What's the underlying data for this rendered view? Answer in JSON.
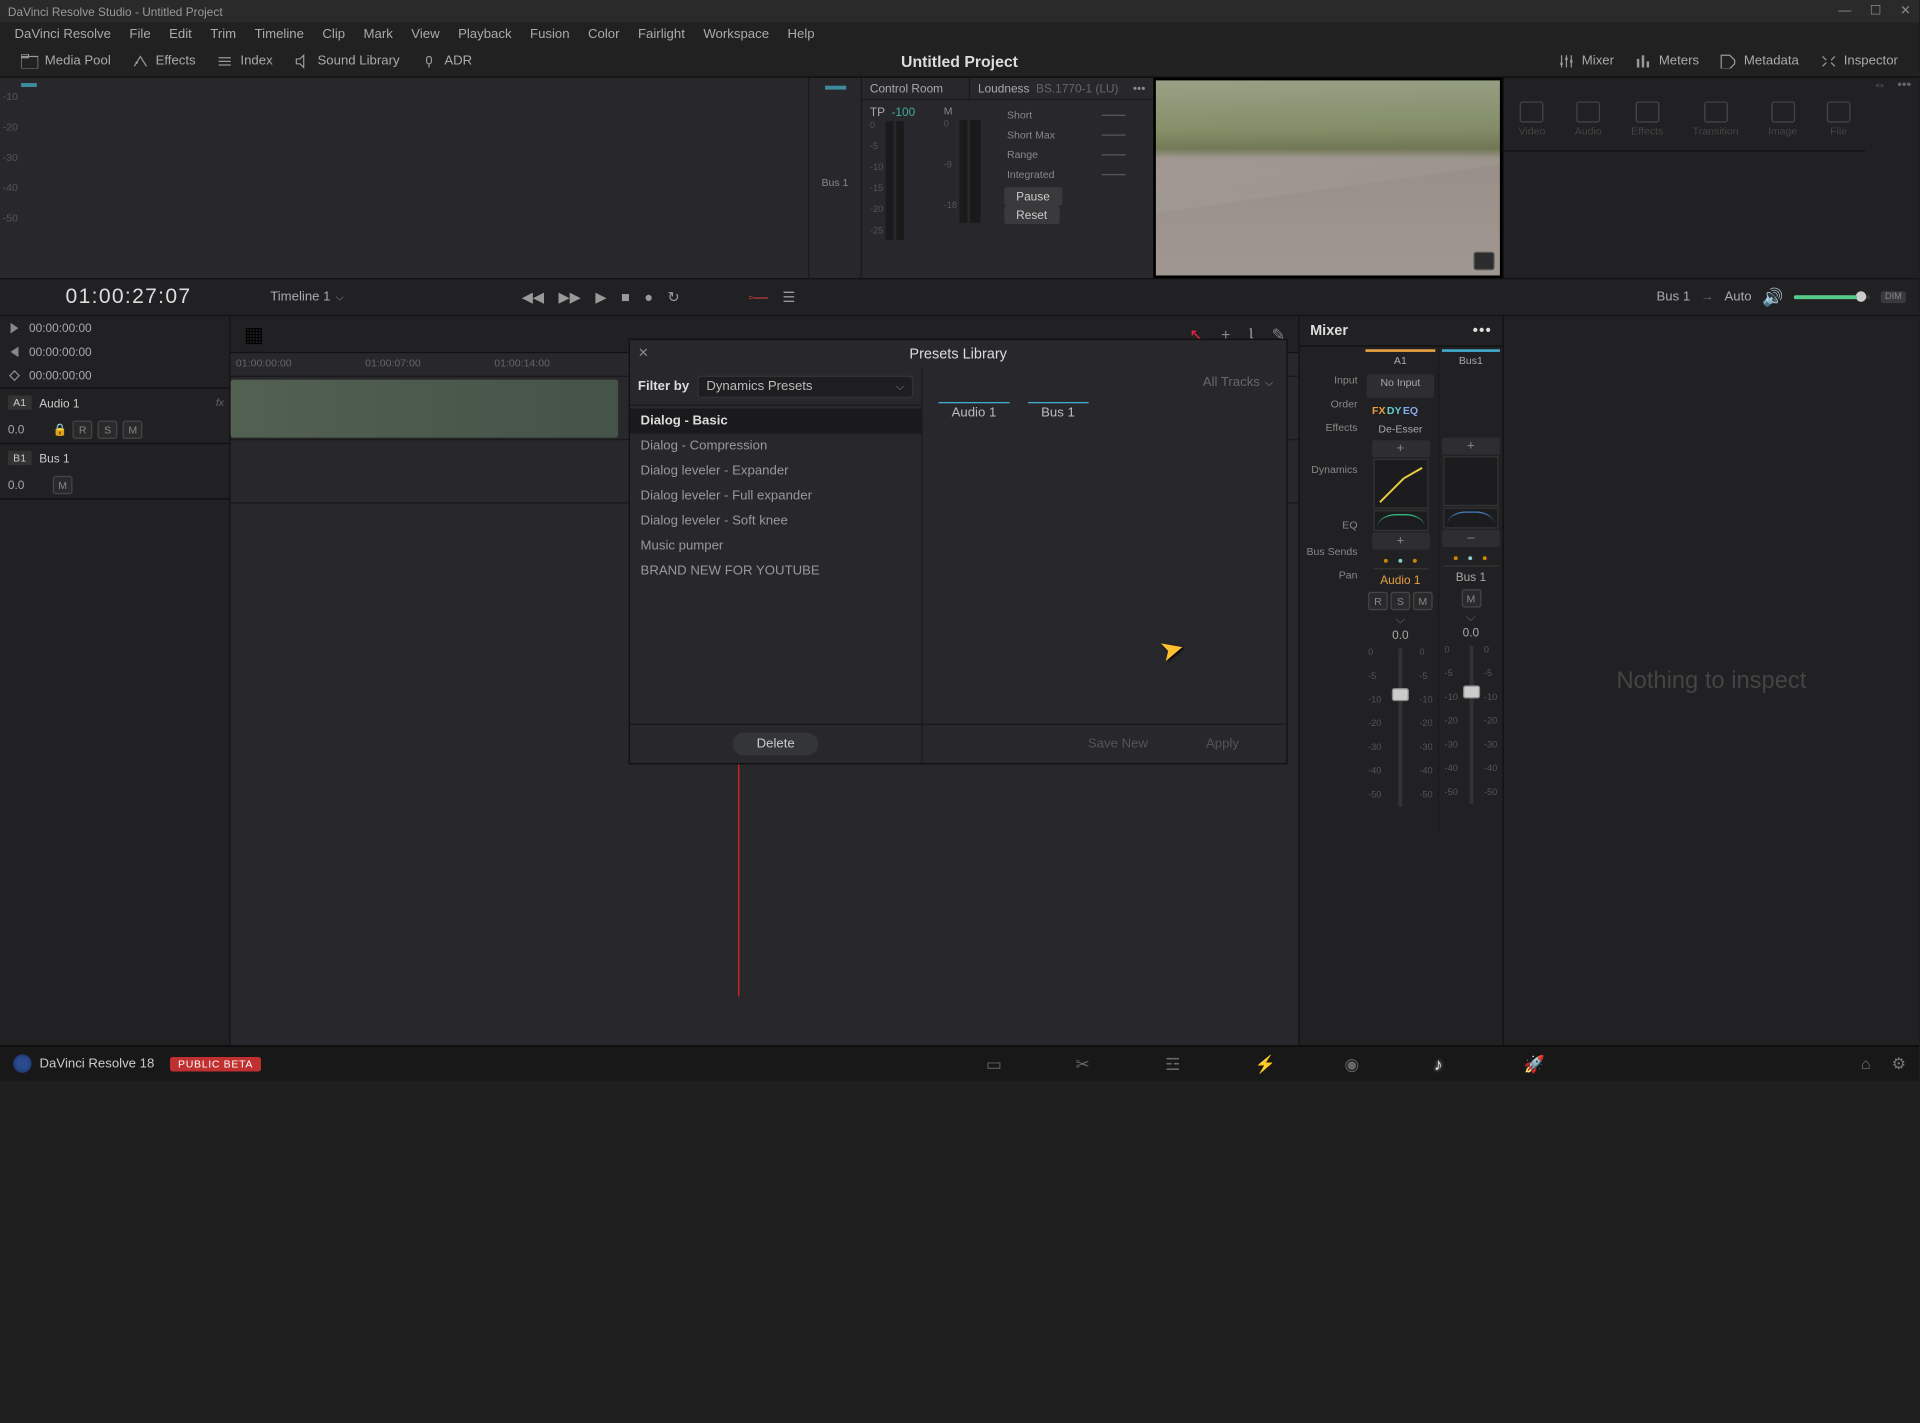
{
  "title_bar": "DaVinci Resolve Studio - Untitled Project",
  "menus": [
    "DaVinci Resolve",
    "File",
    "Edit",
    "Trim",
    "Timeline",
    "Clip",
    "Mark",
    "View",
    "Playback",
    "Fusion",
    "Color",
    "Fairlight",
    "Workspace",
    "Help"
  ],
  "toolbar": {
    "media_pool": "Media Pool",
    "effects": "Effects",
    "index": "Index",
    "sound_library": "Sound Library",
    "adr": "ADR",
    "mixer": "Mixer",
    "meters": "Meters",
    "metadata": "Metadata",
    "inspector": "Inspector"
  },
  "project_title": "Untitled Project",
  "meter_scale": [
    "-10",
    "-20",
    "-30",
    "-40",
    "-50"
  ],
  "bus_meter": {
    "label": "Bus 1"
  },
  "control_room": {
    "title": "Control Room",
    "tp": "TP",
    "tp_val": "-100",
    "tp_scale": [
      "0",
      "-5",
      "-10",
      "-15",
      "-20",
      "-25"
    ]
  },
  "loudness": {
    "title": "Loudness",
    "standard": "BS.1770-1 (LU)",
    "m": "M",
    "short": "Short",
    "short_max": "Short Max",
    "range": "Range",
    "integrated": "Integrated",
    "pause": "Pause",
    "reset": "Reset",
    "m_scale": [
      "0",
      "-9",
      "-18"
    ]
  },
  "inspector_tabs": [
    "Video",
    "Audio",
    "Effects",
    "Transition",
    "Image",
    "File"
  ],
  "timecode": "01:00:27:07",
  "timeline_name": "Timeline 1",
  "tc_rows": [
    "00:00:00:00",
    "00:00:00:00",
    "00:00:00:00"
  ],
  "tracks": [
    {
      "num": "A1",
      "name": "Audio 1",
      "val": "0.0",
      "btns": [
        "R",
        "S",
        "M"
      ],
      "fx": true
    },
    {
      "num": "B1",
      "name": "Bus 1",
      "val": "0.0",
      "btns": [
        "M"
      ],
      "fx": false
    }
  ],
  "ruler": [
    "01:00:00:00",
    "01:00:07:00",
    "01:00:14:00"
  ],
  "mix_out": {
    "bus": "Bus 1",
    "auto": "Auto",
    "dim": "DIM"
  },
  "presets": {
    "title": "Presets Library",
    "close": "✕",
    "filter_label": "Filter by",
    "filter_value": "Dynamics Presets",
    "items": [
      "Dialog - Basic",
      "Dialog - Compression",
      "Dialog leveler - Expander",
      "Dialog leveler - Full expander",
      "Dialog leveler - Soft knee",
      "Music pumper",
      "BRAND NEW FOR YOUTUBE"
    ],
    "all_tracks": "All Tracks",
    "tabs": [
      "Audio 1",
      "Bus 1"
    ],
    "delete": "Delete",
    "save_new": "Save New",
    "apply": "Apply"
  },
  "mixer": {
    "title": "Mixer",
    "labels": {
      "input": "Input",
      "order": "Order",
      "effects": "Effects",
      "dynamics": "Dynamics",
      "eq": "EQ",
      "bus_sends": "Bus Sends",
      "pan": "Pan"
    },
    "cols": [
      {
        "id": "A1",
        "name": "Audio 1",
        "input": "No Input",
        "deesser": "De-Esser",
        "db": "0.0",
        "rsm": [
          "R",
          "S",
          "M"
        ],
        "accent": true
      },
      {
        "id": "Bus1",
        "name": "Bus 1",
        "input": "",
        "deesser": "",
        "db": "0.0",
        "rsm": [
          "M"
        ],
        "accent": false
      }
    ],
    "fader_scale": [
      "0",
      "-5",
      "-10",
      "-20",
      "-30",
      "-40",
      "-50"
    ]
  },
  "inspector_empty": "Nothing to inspect",
  "bottom": {
    "app": "DaVinci Resolve 18",
    "beta": "PUBLIC BETA"
  }
}
